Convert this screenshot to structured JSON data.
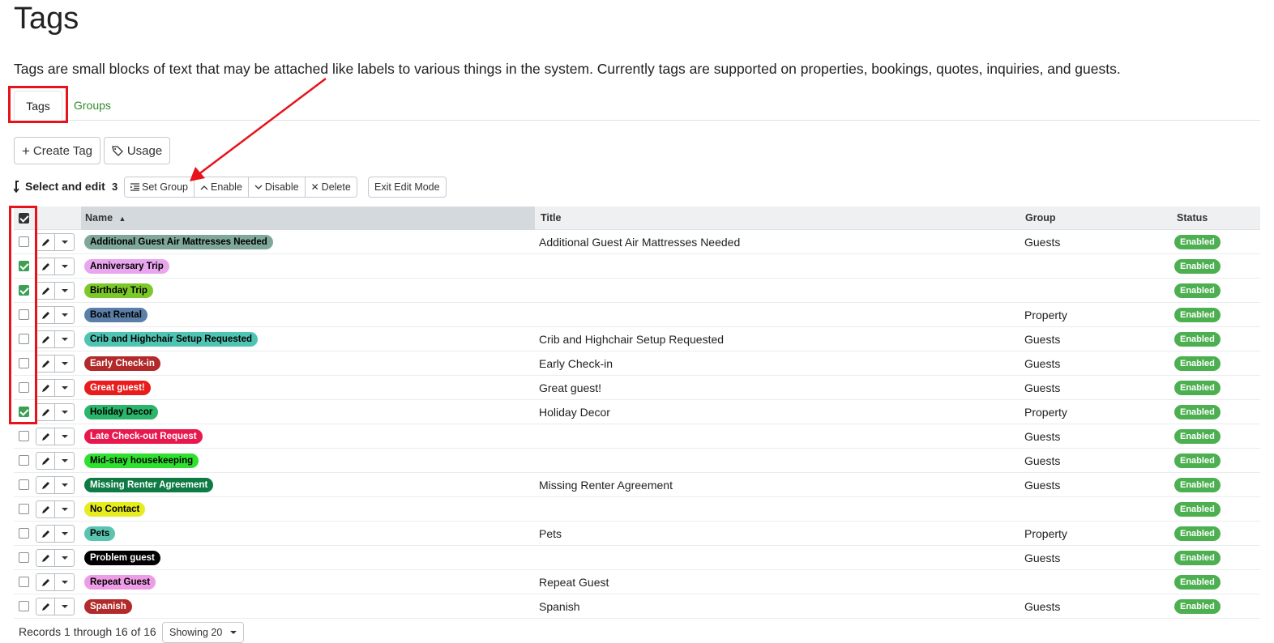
{
  "page": {
    "title": "Tags",
    "description": "Tags are small blocks of text that may be attached like labels to various things in the system. Currently tags are supported on properties, bookings, quotes, inquiries, and guests."
  },
  "tabs": [
    {
      "label": "Tags",
      "active": true
    },
    {
      "label": "Groups",
      "active": false
    }
  ],
  "toolbar": {
    "create_tag": "Create Tag",
    "usage": "Usage"
  },
  "edit_bar": {
    "select_label": "Select and edit",
    "selected_count": "3",
    "set_group": "Set Group",
    "enable": "Enable",
    "disable": "Disable",
    "delete": "Delete",
    "exit_edit_mode": "Exit Edit Mode"
  },
  "table": {
    "columns": {
      "name": "Name",
      "title": "Title",
      "group": "Group",
      "status": "Status"
    },
    "sort": {
      "column": "Name",
      "direction": "ascending"
    },
    "rows": [
      {
        "name": "Additional Guest Air Mattresses Needed",
        "title": "Additional Guest Air Mattresses Needed",
        "group": "Guests",
        "status": "Enabled",
        "checked": false,
        "tag_bg": "#7fa89a",
        "tag_fg": "#000000"
      },
      {
        "name": "Anniversary Trip",
        "title": "",
        "group": "",
        "status": "Enabled",
        "checked": true,
        "tag_bg": "#e9a6ee",
        "tag_fg": "#000000"
      },
      {
        "name": "Birthday Trip",
        "title": "",
        "group": "",
        "status": "Enabled",
        "checked": true,
        "tag_bg": "#7cc82a",
        "tag_fg": "#000000"
      },
      {
        "name": "Boat Rental",
        "title": "",
        "group": "Property",
        "status": "Enabled",
        "checked": false,
        "tag_bg": "#5b7fa8",
        "tag_fg": "#000000"
      },
      {
        "name": "Crib and Highchair Setup Requested",
        "title": "Crib and Highchair Setup Requested",
        "group": "Guests",
        "status": "Enabled",
        "checked": false,
        "tag_bg": "#4fc4b2",
        "tag_fg": "#000000"
      },
      {
        "name": "Early Check-in",
        "title": "Early Check-in",
        "group": "Guests",
        "status": "Enabled",
        "checked": false,
        "tag_bg": "#b22a2a",
        "tag_fg": "#ffffff"
      },
      {
        "name": "Great guest!",
        "title": "Great guest!",
        "group": "Guests",
        "status": "Enabled",
        "checked": false,
        "tag_bg": "#e81c1c",
        "tag_fg": "#ffffff"
      },
      {
        "name": "Holiday Decor",
        "title": "Holiday Decor",
        "group": "Property",
        "status": "Enabled",
        "checked": true,
        "tag_bg": "#2bb56a",
        "tag_fg": "#000000"
      },
      {
        "name": "Late Check-out Request",
        "title": "",
        "group": "Guests",
        "status": "Enabled",
        "checked": false,
        "tag_bg": "#e8184e",
        "tag_fg": "#ffffff"
      },
      {
        "name": "Mid-stay housekeeping",
        "title": "",
        "group": "Guests",
        "status": "Enabled",
        "checked": false,
        "tag_bg": "#2fe02f",
        "tag_fg": "#000000"
      },
      {
        "name": "Missing Renter Agreement",
        "title": "Missing Renter Agreement",
        "group": "Guests",
        "status": "Enabled",
        "checked": false,
        "tag_bg": "#0e7a44",
        "tag_fg": "#ffffff"
      },
      {
        "name": "No Contact",
        "title": "",
        "group": "",
        "status": "Enabled",
        "checked": false,
        "tag_bg": "#e6ec1e",
        "tag_fg": "#000000"
      },
      {
        "name": "Pets",
        "title": "Pets",
        "group": "Property",
        "status": "Enabled",
        "checked": false,
        "tag_bg": "#5bc4b0",
        "tag_fg": "#000000"
      },
      {
        "name": "Problem guest",
        "title": "",
        "group": "Guests",
        "status": "Enabled",
        "checked": false,
        "tag_bg": "#000000",
        "tag_fg": "#ffffff"
      },
      {
        "name": "Repeat Guest",
        "title": "Repeat Guest",
        "group": "",
        "status": "Enabled",
        "checked": false,
        "tag_bg": "#ee9ce6",
        "tag_fg": "#000000"
      },
      {
        "name": "Spanish",
        "title": "Spanish",
        "group": "Guests",
        "status": "Enabled",
        "checked": false,
        "tag_bg": "#b22a2a",
        "tag_fg": "#ffffff"
      }
    ]
  },
  "footer": {
    "records": "Records 1 through 16 of 16",
    "showing": "Showing 20"
  },
  "colors": {
    "link": "#2e8b2e",
    "status_enabled": "#4caf50",
    "highlight": "#e8121a",
    "checkbox_checked": "#3d9f53"
  },
  "icons": [
    "plus-icon",
    "tag-icon",
    "select-arrow-icon",
    "indent-icon",
    "chevron-up-icon",
    "chevron-down-icon",
    "x-icon",
    "sort-up-icon",
    "pencil-icon",
    "caret-down-icon"
  ]
}
